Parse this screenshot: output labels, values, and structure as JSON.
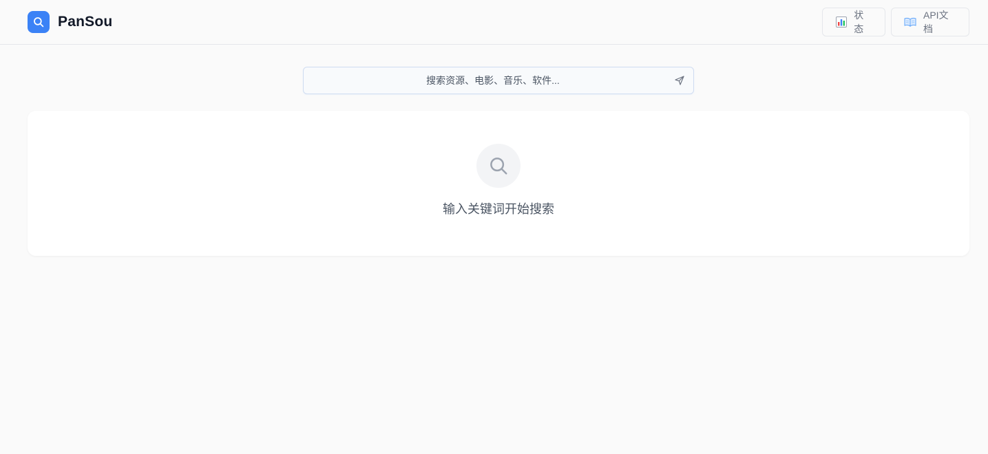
{
  "app": {
    "name": "PanSou",
    "logo_icon": "search-icon",
    "accent_color": "#3b82f6"
  },
  "header": {
    "buttons": [
      {
        "label": "状态",
        "icon": "bar-chart-icon"
      },
      {
        "label": "API文档",
        "icon": "open-book-icon"
      }
    ]
  },
  "search": {
    "placeholder": "搜索资源、电影、音乐、软件...",
    "value": "",
    "submit_icon": "send-icon"
  },
  "empty_state": {
    "icon": "search-icon",
    "message": "输入关键词开始搜索"
  }
}
